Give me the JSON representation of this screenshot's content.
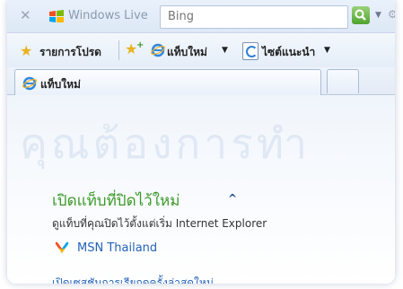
{
  "search_bar": {
    "provider_label": "Windows Live",
    "placeholder": "Bing"
  },
  "favorites_bar": {
    "favorites_label": "รายการโปรด",
    "items": [
      {
        "label": "แท็บใหม่",
        "icon": "ie-icon",
        "has_dropdown": true
      },
      {
        "label": "ไซต์แนะนำ",
        "icon": "suggested-sites-icon",
        "has_dropdown": true
      }
    ]
  },
  "tabs": [
    {
      "title": "แท็บใหม่",
      "active": true,
      "icon": "ie-icon"
    }
  ],
  "new_tab_page": {
    "watermark": "คุณต้องการทำ",
    "reopen_heading": "เปิดแท็บที่ปิดไว้ใหม่",
    "reopen_description": "ดูแท็บที่คุณปิดไว้ตั้งแต่เริ่ม Internet Explorer",
    "recent_links": [
      {
        "label": "MSN Thailand",
        "icon": "msn-butterfly-icon"
      }
    ],
    "last_session_link": "เปิดเซสชันการเรียกดูครั้งล่าสุดใหม่"
  },
  "colors": {
    "heading_green": "#3c9a2a",
    "link_blue": "#2463b8",
    "chrome_blue": "#dde8f6"
  }
}
